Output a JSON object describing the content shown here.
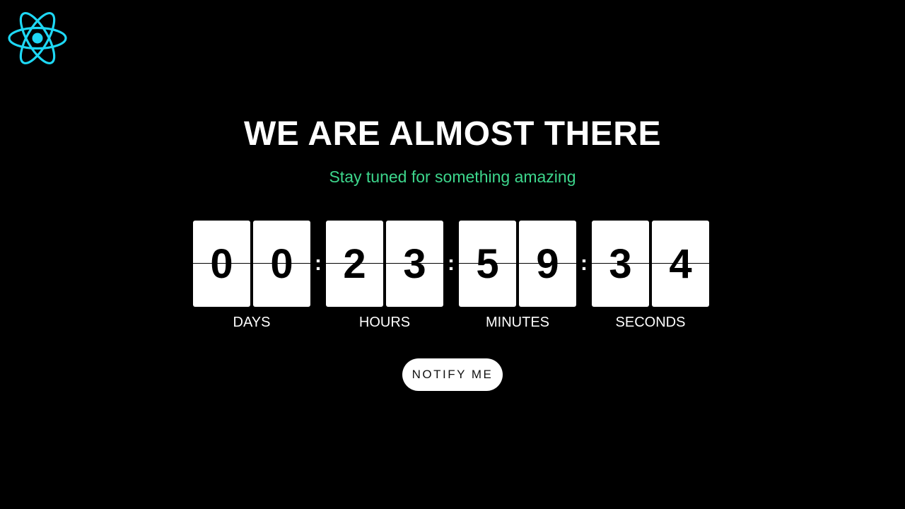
{
  "logo": {
    "icon": "react-atom-icon",
    "color": "#1ed8f5"
  },
  "headline": "WE ARE ALMOST THERE",
  "subline": {
    "text": "Stay tuned for something amazing",
    "color": "#3dd68c"
  },
  "countdown": {
    "separator": ":",
    "units": [
      {
        "label": "DAYS",
        "digits": [
          "0",
          "0"
        ]
      },
      {
        "label": "HOURS",
        "digits": [
          "2",
          "3"
        ]
      },
      {
        "label": "MINUTES",
        "digits": [
          "5",
          "9"
        ]
      },
      {
        "label": "SECONDS",
        "digits": [
          "3",
          "4"
        ]
      }
    ]
  },
  "notify_button": {
    "label": "NOTIFY ME"
  }
}
